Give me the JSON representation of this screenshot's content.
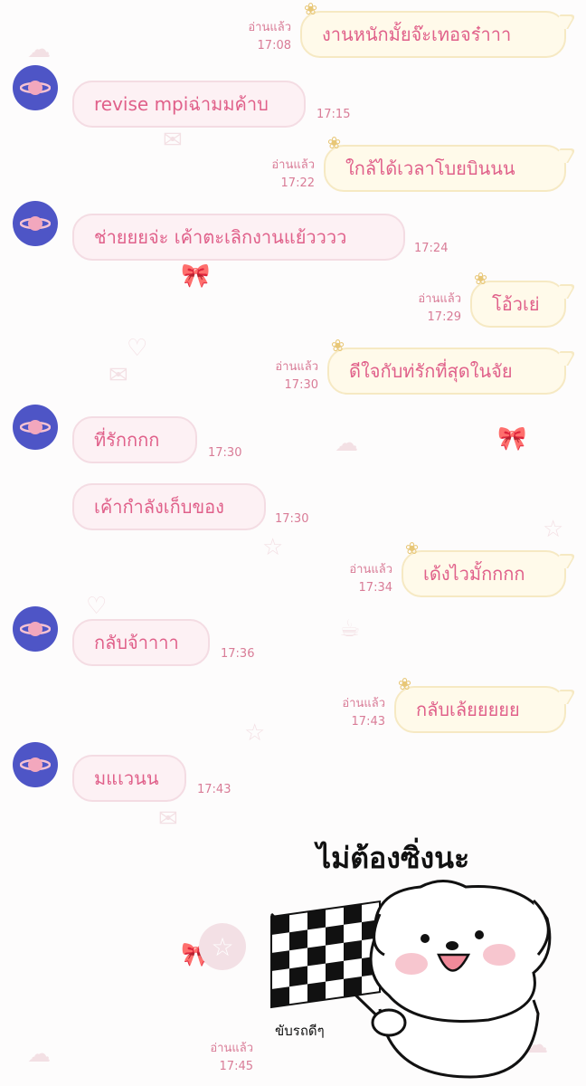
{
  "read_label": "อ่านแล้ว",
  "messages": [
    {
      "side": "out",
      "text": "งานหนักมั้ยจ๊ะเทอจร๋าาา",
      "time": "17:08",
      "read": true
    },
    {
      "side": "in",
      "text": "revise mpiฉ่ามมค้าบ",
      "time": "17:15",
      "avatar": true
    },
    {
      "side": "out",
      "text": "ใกล้ได้เวลาโบยบินนน",
      "time": "17:22",
      "read": true
    },
    {
      "side": "in",
      "text": "ช่ายยยจ่ะ เค้าตะเลิกงานแย้วววว",
      "time": "17:24",
      "avatar": true
    },
    {
      "side": "out",
      "text": "โอ้วเย่",
      "time": "17:29",
      "read": true
    },
    {
      "side": "out",
      "text": "ดีใจกับท่รักที่สุดในจัย",
      "time": "17:30",
      "read": true
    },
    {
      "side": "in",
      "text": "ที่รักกกก",
      "time": "17:30",
      "avatar": true
    },
    {
      "side": "in",
      "text": "เค้ากำลังเก็บของ",
      "time": "17:30",
      "avatar": false
    },
    {
      "side": "out",
      "text": "เด้งไวมั้กกกก",
      "time": "17:34",
      "read": true
    },
    {
      "side": "in",
      "text": "กลับจ้าาาา",
      "time": "17:36",
      "avatar": true
    },
    {
      "side": "out",
      "text": "กลับเล้ยยยยย",
      "time": "17:43",
      "read": true
    },
    {
      "side": "in",
      "text": "มแเวนน",
      "time": "17:43",
      "avatar": true
    }
  ],
  "sticker": {
    "caption_top": "ไม่ต้องซิ่งนะ",
    "caption_bottom": "ขับรถดีๆ",
    "time": "17:45",
    "read": true
  },
  "icons": {
    "avatar": "planet-icon",
    "sticker_button": "star-icon",
    "bow": "bow-icon"
  },
  "colors": {
    "text": "#e0608a",
    "incoming_bubble": "#fdf1f4",
    "outgoing_bubble": "#fffaea",
    "avatar_bg": "#4e55c6"
  }
}
